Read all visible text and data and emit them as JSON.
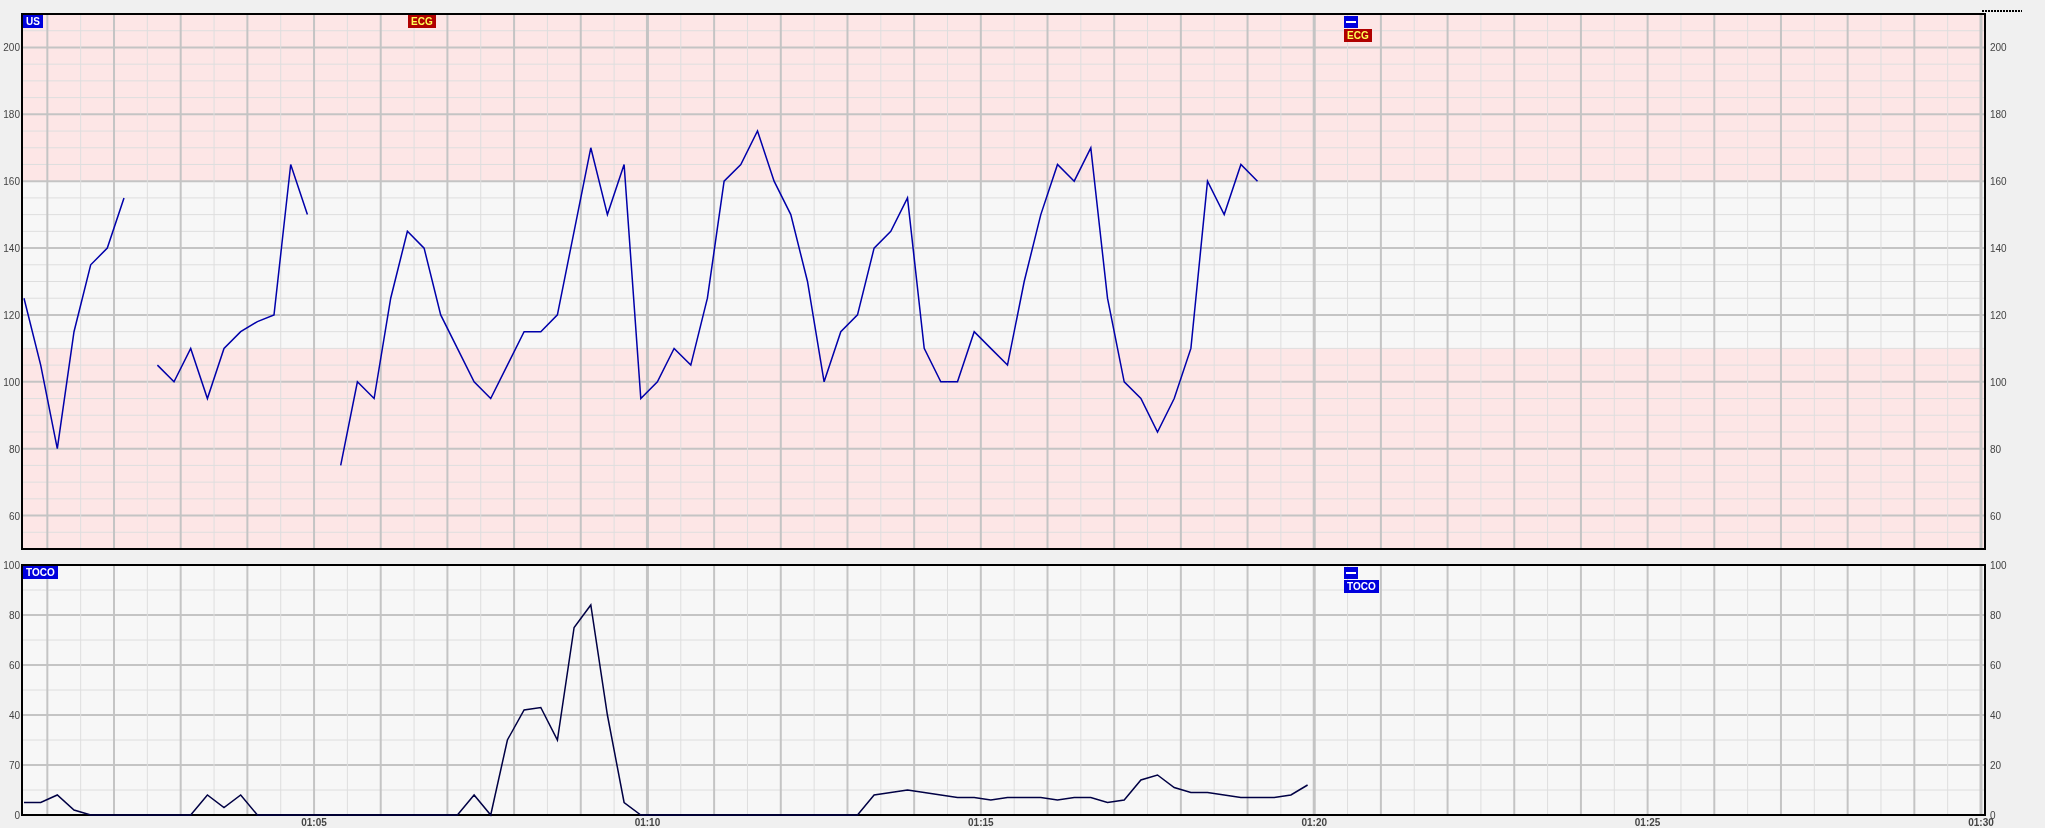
{
  "fhr_panel": {
    "markers": [
      {
        "label": "US",
        "color": "#0000dd"
      },
      {
        "label": "ECG",
        "color": "#b00000"
      }
    ],
    "event_marker": {
      "label": "ECG",
      "color": "#b00000"
    },
    "left_axis_labels": [
      "200",
      "180",
      "160",
      "140",
      "120",
      "100",
      "80",
      "60"
    ],
    "chart_data": {
      "type": "line",
      "grid": true,
      "xlim": [
        60.62,
        90.06
      ],
      "ylim": [
        50,
        210
      ],
      "yticks": [
        {
          "value": 200,
          "label": "200"
        },
        {
          "value": 180,
          "label": "180"
        },
        {
          "value": 160,
          "label": "160"
        },
        {
          "value": 140,
          "label": "140"
        },
        {
          "value": 120,
          "label": "120"
        },
        {
          "value": 100,
          "label": "100"
        },
        {
          "value": 80,
          "label": "80"
        },
        {
          "value": 60,
          "label": "60"
        }
      ],
      "x": [
        60.65,
        60.9,
        61.15,
        61.4,
        61.65,
        61.9,
        62.15,
        62.4,
        62.65,
        62.9,
        63.15,
        63.4,
        63.65,
        63.9,
        64.15,
        64.4,
        64.65,
        64.9,
        65.15,
        65.4,
        65.65,
        65.9,
        66.15,
        66.4,
        66.65,
        66.9,
        67.15,
        67.4,
        67.65,
        67.9,
        68.15,
        68.4,
        68.65,
        68.9,
        69.15,
        69.4,
        69.65,
        69.9,
        70.15,
        70.4,
        70.65,
        70.9,
        71.15,
        71.4,
        71.65,
        71.9,
        72.15,
        72.4,
        72.65,
        72.9,
        73.15,
        73.4,
        73.65,
        73.9,
        74.15,
        74.4,
        74.65,
        74.9,
        75.15,
        75.4,
        75.65,
        75.9,
        76.15,
        76.4,
        76.65,
        76.9,
        77.15,
        77.4,
        77.65,
        77.9,
        78.15,
        78.4,
        78.65,
        78.9,
        79.15
      ],
      "series": [
        {
          "color": "#0000aa",
          "values": [
            125,
            105,
            80,
            115,
            135,
            140,
            155,
            null,
            105,
            100,
            110,
            95,
            110,
            115,
            118,
            120,
            165,
            150,
            null,
            75,
            100,
            95,
            125,
            145,
            140,
            120,
            110,
            100,
            95,
            105,
            115,
            115,
            120,
            145,
            170,
            150,
            165,
            95,
            100,
            110,
            105,
            125,
            160,
            165,
            175,
            160,
            150,
            130,
            100,
            115,
            120,
            140,
            145,
            155,
            110,
            100,
            100,
            115,
            110,
            105,
            130,
            150,
            165,
            160,
            170,
            125,
            100,
            95,
            85,
            95,
            110,
            160,
            150,
            165,
            160
          ]
        }
      ]
    }
  },
  "toco_panel": {
    "markers": [
      {
        "label": "TOCO",
        "color": "#0000dd"
      }
    ],
    "event_marker": {
      "label": "TOCO",
      "color": "#0000dd"
    },
    "left_axis_labels": [
      "100",
      "80",
      "60",
      "40",
      "70",
      "0"
    ],
    "chart_data": {
      "type": "line",
      "grid": true,
      "xlim": [
        60.62,
        90.06
      ],
      "ylim": [
        0,
        100
      ],
      "yticks": [
        {
          "value": 100,
          "label": "100"
        },
        {
          "value": 80,
          "label": "80"
        },
        {
          "value": 60,
          "label": "60"
        },
        {
          "value": 40,
          "label": "40"
        },
        {
          "value": 20,
          "label": "20"
        },
        {
          "value": 0,
          "label": "0"
        }
      ],
      "xticks": [
        {
          "value": 65,
          "label": "01:05"
        },
        {
          "value": 70,
          "label": "01:10"
        },
        {
          "value": 75,
          "label": "01:15"
        },
        {
          "value": 80,
          "label": "01:20"
        },
        {
          "value": 85,
          "label": "01:25"
        },
        {
          "value": 90,
          "label": "01:30"
        }
      ],
      "x": [
        60.65,
        60.9,
        61.15,
        61.4,
        61.65,
        61.9,
        62.15,
        62.4,
        62.65,
        62.9,
        63.15,
        63.4,
        63.65,
        63.9,
        64.15,
        64.4,
        64.65,
        64.9,
        65.15,
        65.4,
        65.65,
        65.9,
        66.15,
        66.4,
        66.65,
        66.9,
        67.15,
        67.4,
        67.65,
        67.9,
        68.15,
        68.4,
        68.65,
        68.9,
        69.15,
        69.4,
        69.65,
        69.9,
        70.15,
        70.4,
        70.65,
        70.9,
        71.15,
        71.4,
        71.65,
        71.9,
        72.15,
        72.4,
        72.65,
        72.9,
        73.15,
        73.4,
        73.65,
        73.9,
        74.15,
        74.4,
        74.65,
        74.9,
        75.15,
        75.4,
        75.65,
        75.9,
        76.15,
        76.4,
        76.65,
        76.9,
        77.15,
        77.4,
        77.65,
        77.9,
        78.15,
        78.4,
        78.65,
        78.9,
        79.15,
        79.4,
        79.65,
        79.9
      ],
      "series": [
        {
          "color": "#000044",
          "values": [
            5,
            5,
            8,
            2,
            0,
            0,
            0,
            0,
            0,
            0,
            0,
            8,
            3,
            8,
            0,
            0,
            0,
            0,
            0,
            0,
            0,
            0,
            0,
            0,
            0,
            0,
            0,
            8,
            0,
            30,
            42,
            43,
            30,
            75,
            84,
            40,
            5,
            0,
            0,
            0,
            0,
            0,
            0,
            0,
            0,
            0,
            0,
            0,
            0,
            0,
            0,
            8,
            9,
            10,
            9,
            8,
            7,
            7,
            6,
            7,
            7,
            7,
            6,
            7,
            7,
            5,
            6,
            14,
            16,
            11,
            9,
            9,
            8,
            7,
            7,
            7,
            8,
            12
          ]
        }
      ]
    }
  }
}
